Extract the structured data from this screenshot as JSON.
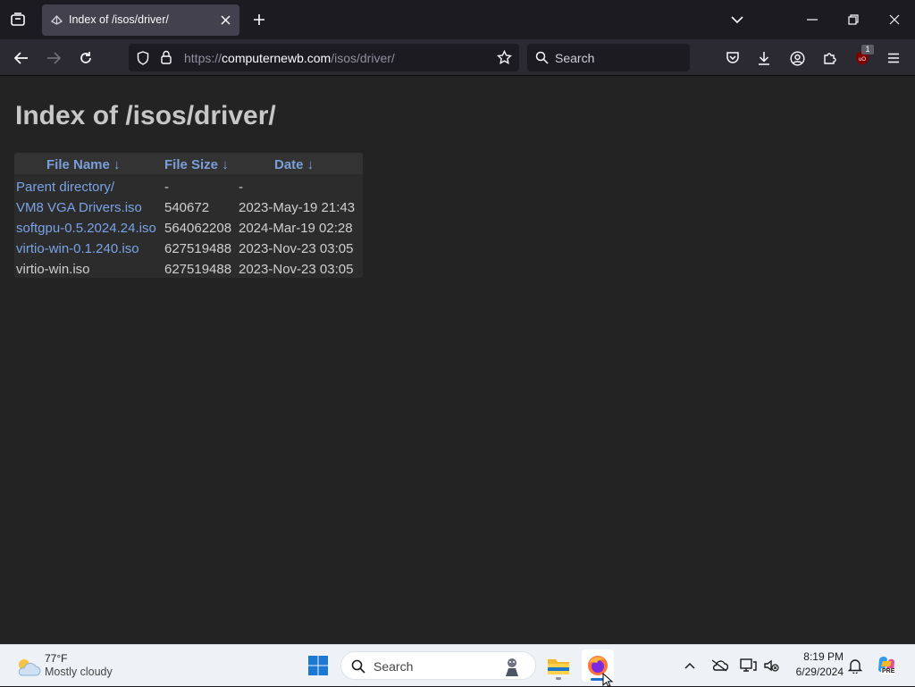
{
  "browser": {
    "tab_title": "Index of /isos/driver/",
    "url_scheme": "https://",
    "url_host": "computernewb.com",
    "url_path": "/isos/driver/",
    "search_placeholder": "Search",
    "extension_badge": "1"
  },
  "page": {
    "title": "Index of /isos/driver/",
    "columns": [
      "File Name ↓",
      "File Size ↓",
      "Date ↓"
    ],
    "rows": [
      {
        "name": "Parent directory/",
        "size": "-",
        "date": "-",
        "name_link": true
      },
      {
        "name": "VM8 VGA Drivers.iso",
        "size": "540672",
        "date": "2023-May-19 21:43",
        "name_link": true
      },
      {
        "name": "softgpu-0.5.2024.24.iso",
        "size": "564062208",
        "date": "2024-Mar-19 02:28",
        "name_link": true
      },
      {
        "name": "virtio-win-0.1.240.iso",
        "size": "627519488",
        "date": "2023-Nov-23 03:05",
        "name_link": true
      },
      {
        "name": "virtio-win.iso",
        "size": "627519488",
        "date": "2023-Nov-23 03:05",
        "name_link": false
      }
    ]
  },
  "taskbar": {
    "weather_temp": "77°F",
    "weather_desc": "Mostly cloudy",
    "search_label": "Search",
    "time": "8:19 PM",
    "date": "6/29/2024",
    "copilot_badge": "PRE"
  }
}
